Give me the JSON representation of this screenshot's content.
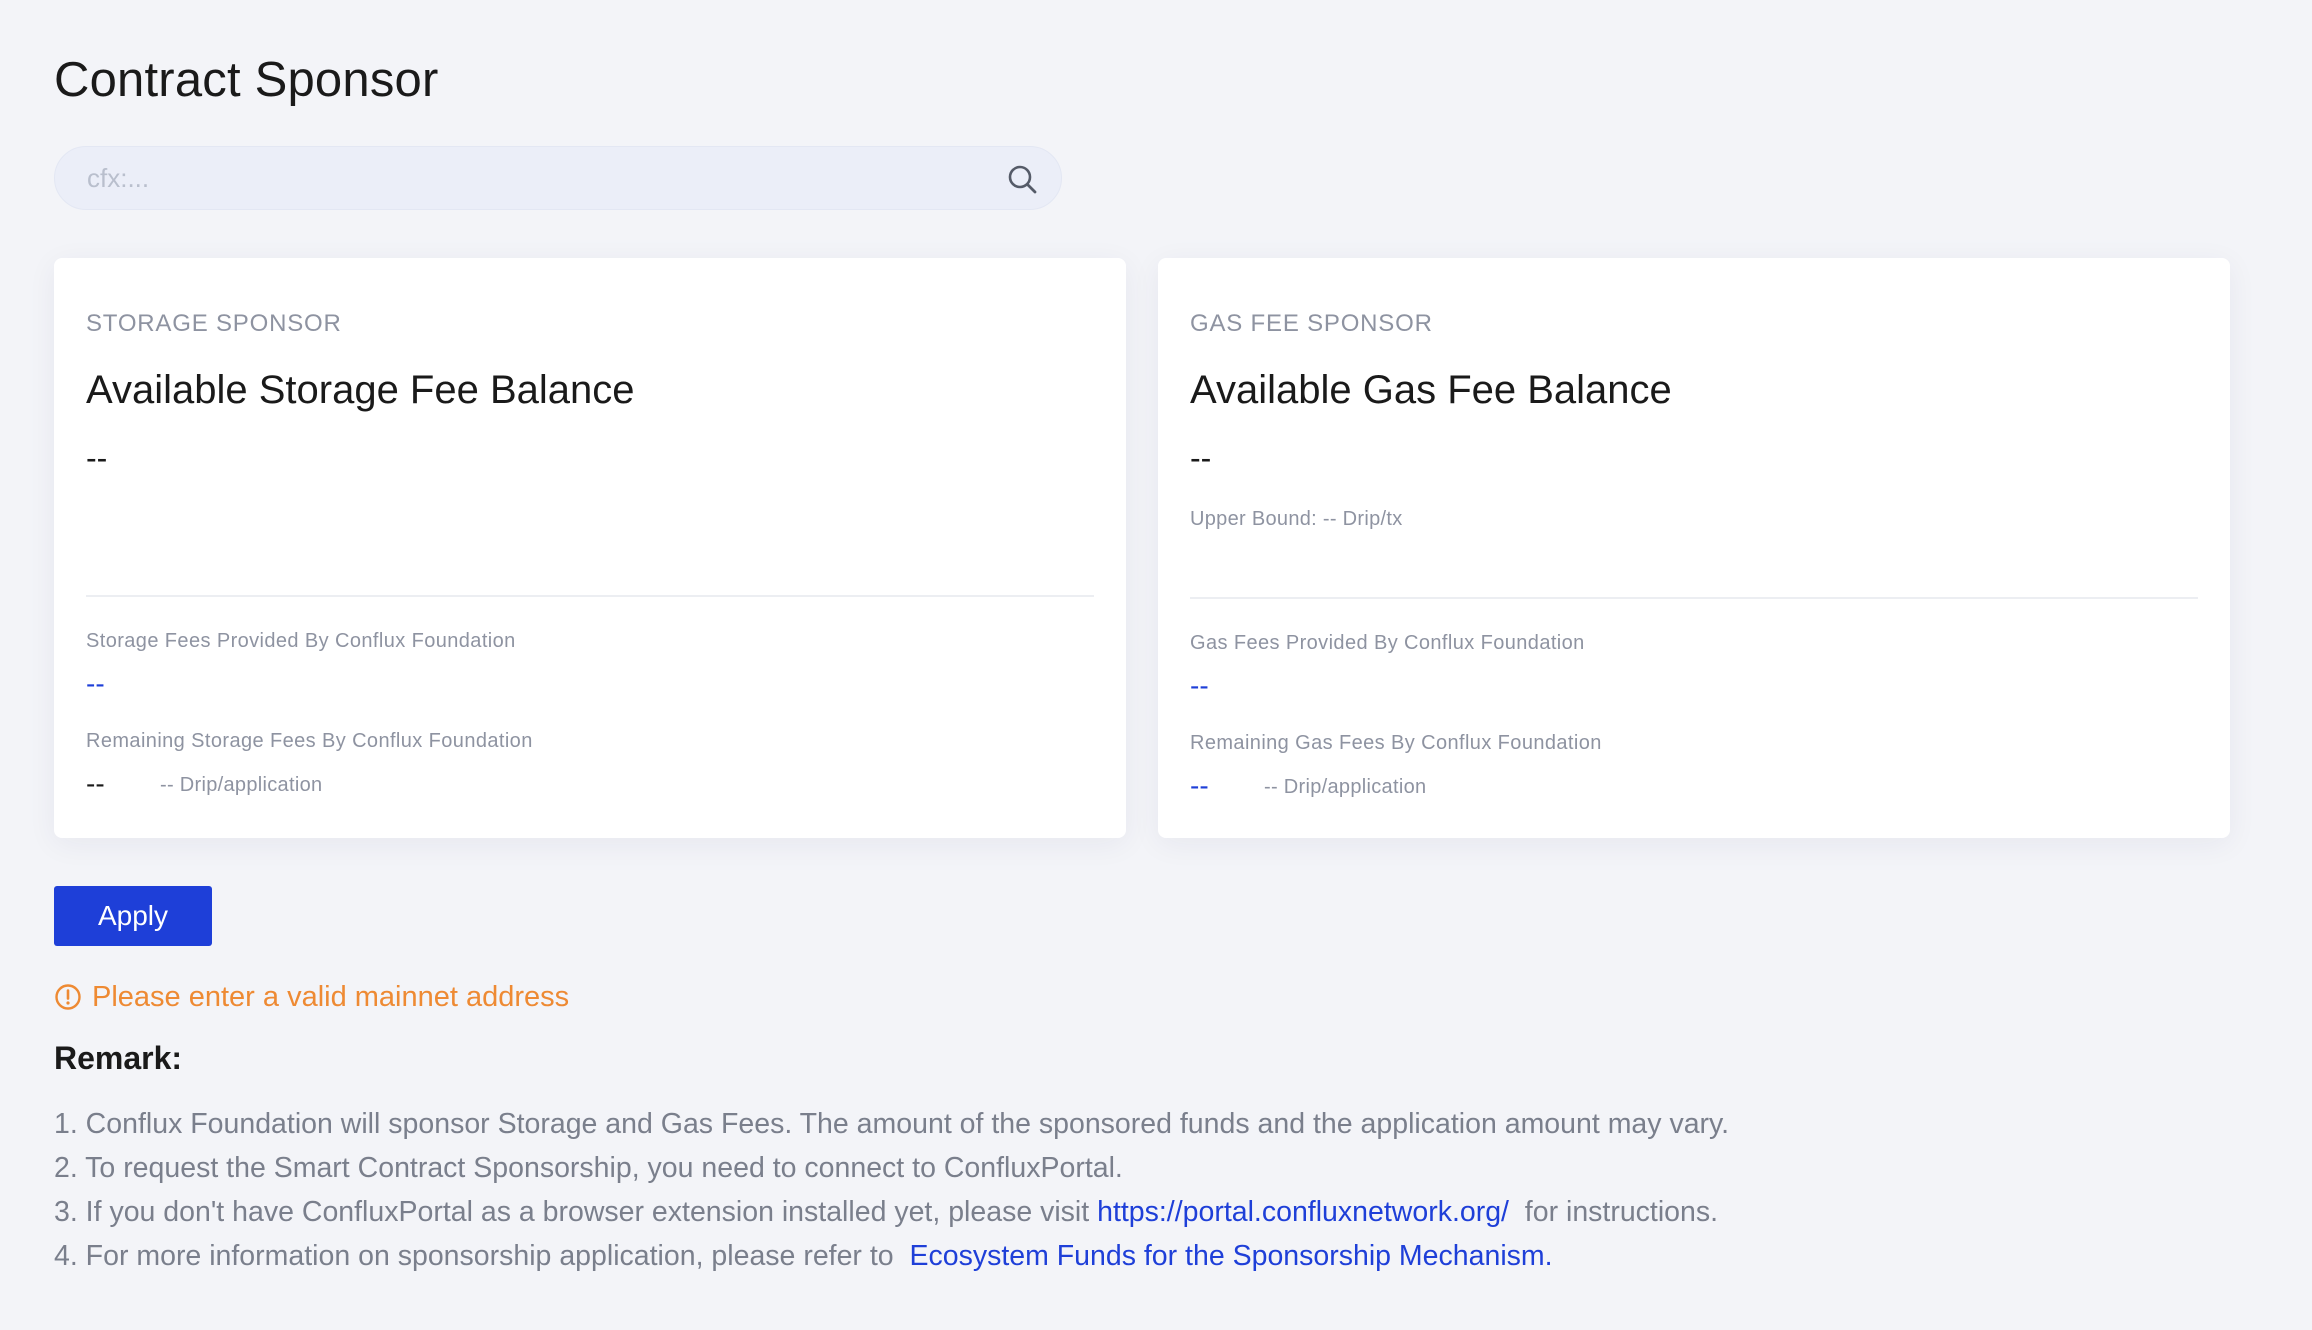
{
  "page": {
    "title": "Contract Sponsor"
  },
  "search": {
    "placeholder": "cfx:...",
    "value": ""
  },
  "storage_card": {
    "kicker": "STORAGE SPONSOR",
    "heading": "Available Storage Fee Balance",
    "balance": "--",
    "provided_label": "Storage Fees Provided By Conflux Foundation",
    "provided_value": "--",
    "remaining_label": "Remaining Storage Fees By Conflux Foundation",
    "remaining_value": "--",
    "remaining_suffix": "-- Drip/application"
  },
  "gas_card": {
    "kicker": "GAS FEE SPONSOR",
    "heading": "Available Gas Fee Balance",
    "balance": "--",
    "upper_bound": "Upper Bound: -- Drip/tx",
    "provided_label": "Gas Fees Provided By Conflux Foundation",
    "provided_value": "--",
    "remaining_label": "Remaining Gas Fees By Conflux Foundation",
    "remaining_value": "--",
    "remaining_suffix": "-- Drip/application"
  },
  "apply_button": {
    "label": "Apply"
  },
  "warning": {
    "text": "Please enter a valid mainnet address"
  },
  "remark": {
    "title": "Remark:",
    "items": [
      {
        "text": "1. Conflux Foundation will sponsor Storage and Gas Fees. The amount of the sponsored funds and the application amount may vary."
      },
      {
        "text": "2. To request the Smart Contract Sponsorship, you need to connect to ConfluxPortal."
      },
      {
        "prefix": "3. If you don't have ConfluxPortal as a browser extension installed yet, please visit ",
        "link": "https://portal.confluxnetwork.org/",
        "suffix": "  for instructions."
      },
      {
        "prefix": "4. For more information on sponsorship application, please refer to  ",
        "link": "Ecosystem Funds for the Sponsorship Mechanism."
      }
    ]
  },
  "colors": {
    "accent": "#1e3fd8",
    "warning": "#ee8a33",
    "muted": "#8e93a1",
    "background": "#f3f4f8"
  },
  "icons": {
    "search": "search-icon",
    "warning": "alert-circle-icon"
  }
}
